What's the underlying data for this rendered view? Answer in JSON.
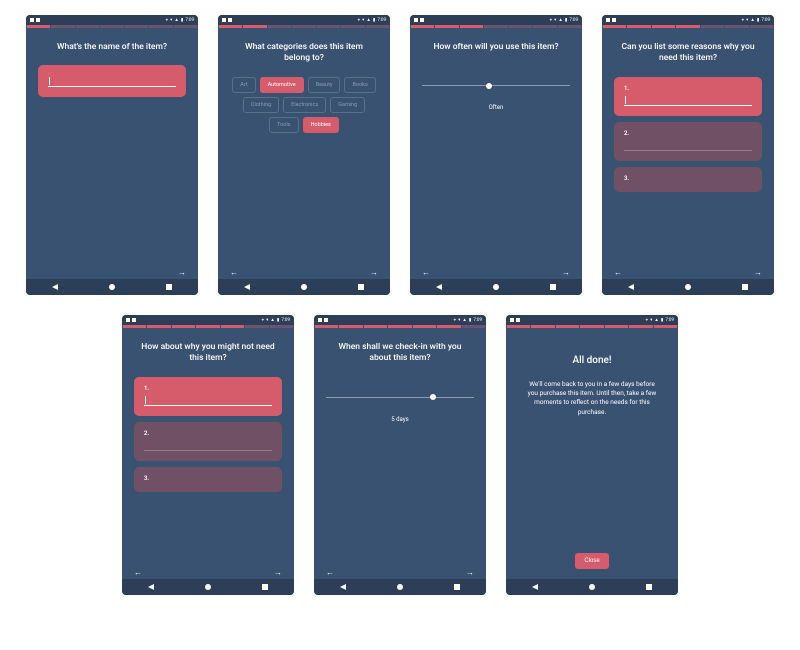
{
  "status": {
    "time": "7:09"
  },
  "screens": [
    {
      "title": "What's the name of the item?",
      "progress_active": 1,
      "nav": {
        "back": false,
        "forward": true
      }
    },
    {
      "title": "What categories does this item belong to?",
      "progress_active": 2,
      "chips": [
        "Art",
        "Automotive",
        "Beauty",
        "Books",
        "Clothing",
        "Electronics",
        "Gaming",
        "Tools",
        "Hobbies"
      ],
      "chips_selected": [
        "Automotive",
        "Hobbies"
      ],
      "nav": {
        "back": true,
        "forward": true
      }
    },
    {
      "title": "How often will you use this item?",
      "progress_active": 3,
      "slider": {
        "pos": 45,
        "label": "Often"
      },
      "nav": {
        "back": true,
        "forward": true
      }
    },
    {
      "title": "Can you list some reasons why you need this item?",
      "progress_active": 4,
      "cards": [
        "1.",
        "2.",
        "3."
      ],
      "nav": {
        "back": true,
        "forward": true
      }
    },
    {
      "title": "How about why you might not need this item?",
      "progress_active": 5,
      "cards": [
        "1.",
        "2.",
        "3."
      ],
      "nav": {
        "back": true,
        "forward": true
      }
    },
    {
      "title": "When shall we check-in with you about this item?",
      "progress_active": 6,
      "slider": {
        "pos": 72,
        "label": "5 days"
      },
      "nav": {
        "back": true,
        "forward": true
      }
    },
    {
      "title": "All done!",
      "progress_active": 7,
      "body": "We'll come back to you in a few days before you purchase this item. Until then, take a few moments to reflect on the needs for this purchase.",
      "close_label": "Close"
    }
  ]
}
